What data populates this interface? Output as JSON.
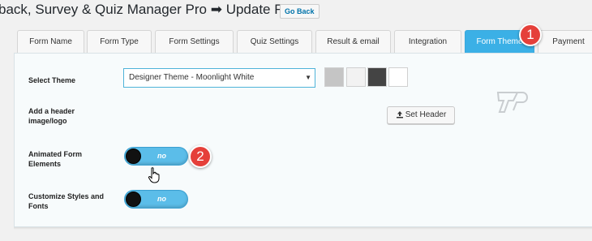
{
  "header": {
    "title": "back, Survey & Quiz Manager Pro ➡ Update Form",
    "go_back": "Go Back"
  },
  "tabs": [
    {
      "label": "Form Name"
    },
    {
      "label": "Form Type"
    },
    {
      "label": "Form Settings"
    },
    {
      "label": "Quiz Settings"
    },
    {
      "label": "Result & email"
    },
    {
      "label": "Integration"
    },
    {
      "label": "Form Theme"
    },
    {
      "label": "Payment"
    }
  ],
  "active_tab": "Form Theme",
  "theme": {
    "label": "Select Theme",
    "selected": "Designer Theme - Moonlight White",
    "swatches": [
      "#c5c5c5",
      "#f2f2f2",
      "#444444",
      "#ffffff"
    ]
  },
  "header_image": {
    "label": "Add a header image/logo",
    "button": "Set Header"
  },
  "animated": {
    "label": "Animated Form Elements",
    "state": "no"
  },
  "customize": {
    "label": "Customize Styles and Fonts",
    "state": "no"
  },
  "annotations": [
    "1",
    "2"
  ],
  "colors": {
    "accent": "#3bb0e6",
    "badge": "#e5403a"
  }
}
